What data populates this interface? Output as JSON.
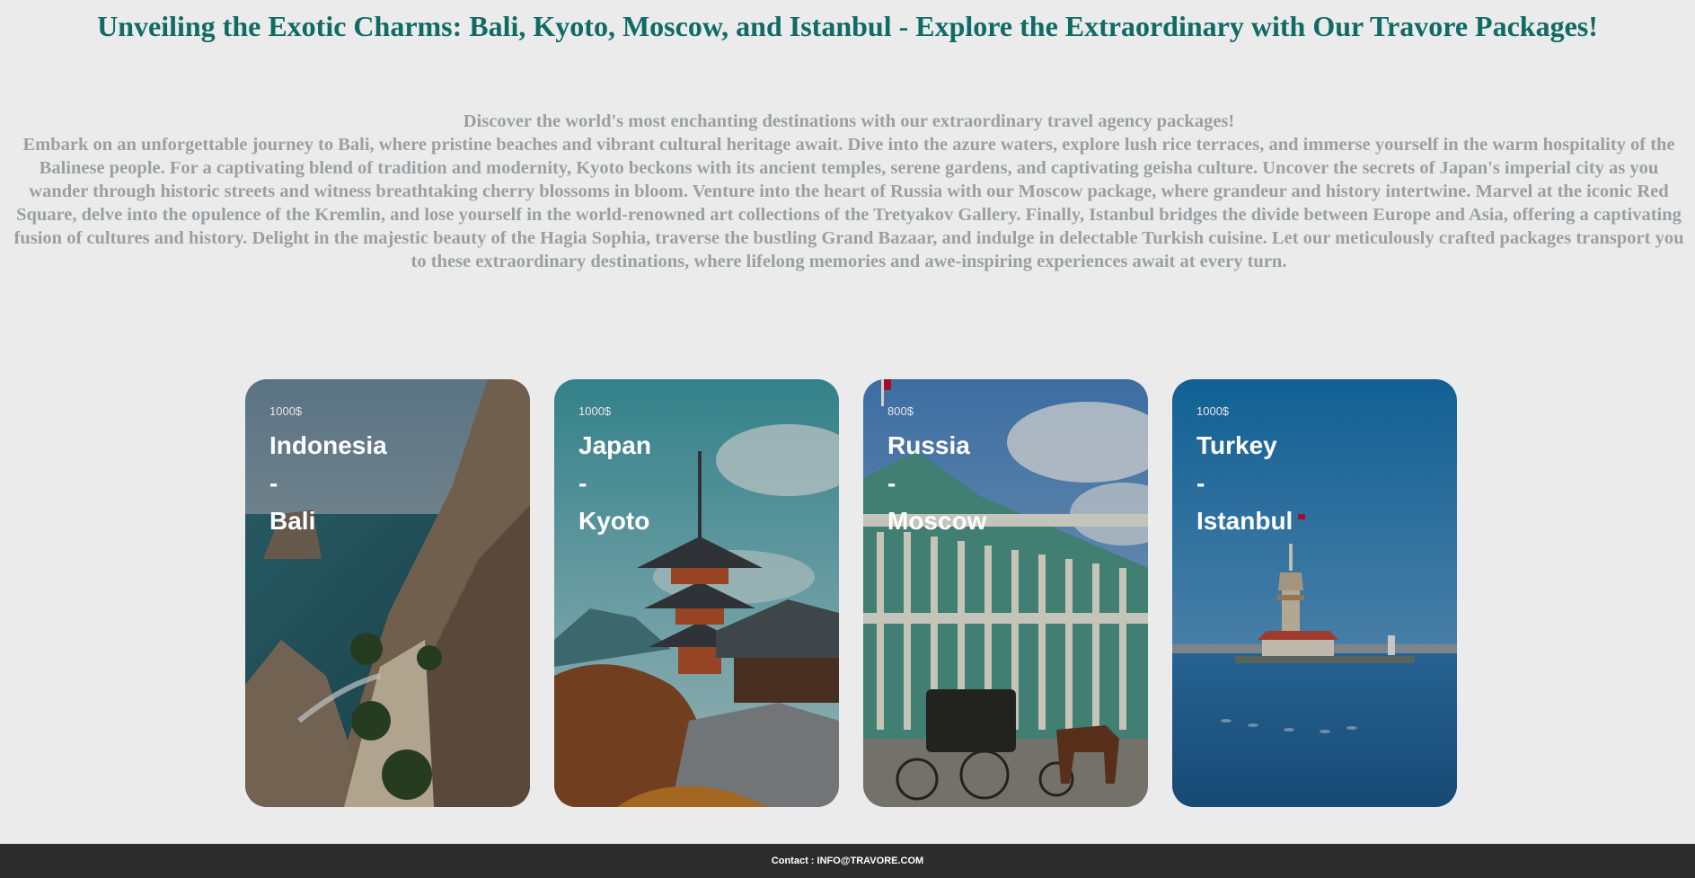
{
  "header": {
    "title": "Unveiling the Exotic Charms: Bali, Kyoto, Moscow, and Istanbul - Explore the Extraordinary with Our Travore Packages!"
  },
  "intro": {
    "lead": "Discover the world's most enchanting destinations with our extraordinary travel agency packages!",
    "body": "Embark on an unforgettable journey to Bali, where pristine beaches and vibrant cultural heritage await. Dive into the azure waters, explore lush rice terraces, and immerse yourself in the warm hospitality of the Balinese people. For a captivating blend of tradition and modernity, Kyoto beckons with its ancient temples, serene gardens, and captivating geisha culture. Uncover the secrets of Japan's imperial city as you wander through historic streets and witness breathtaking cherry blossoms in bloom. Venture into the heart of Russia with our Moscow package, where grandeur and history intertwine. Marvel at the iconic Red Square, delve into the opulence of the Kremlin, and lose yourself in the world-renowned art collections of the Tretyakov Gallery. Finally, Istanbul bridges the divide between Europe and Asia, offering a captivating fusion of cultures and history. Delight in the majestic beauty of the Hagia Sophia, traverse the bustling Grand Bazaar, and indulge in delectable Turkish cuisine. Let our meticulously crafted packages transport you to these extraordinary destinations, where lifelong memories and awe-inspiring experiences await at every turn."
  },
  "packages": [
    {
      "price": "1000$",
      "country": "Indonesia",
      "dash": "-",
      "city": "Bali"
    },
    {
      "price": "1000$",
      "country": "Japan",
      "dash": "-",
      "city": "Kyoto"
    },
    {
      "price": "800$",
      "country": "Russia",
      "dash": "-",
      "city": "Moscow"
    },
    {
      "price": "1000$",
      "country": "Turkey",
      "dash": "-",
      "city": "Istanbul"
    }
  ],
  "footer": {
    "contact": "Contact : INFO@TRAVORE.COM"
  }
}
